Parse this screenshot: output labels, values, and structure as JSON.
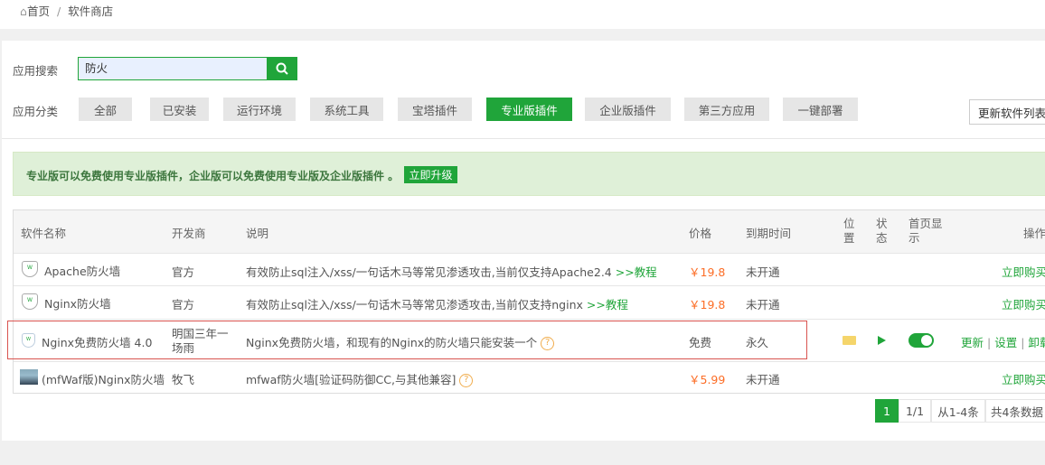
{
  "breadcrumb": {
    "home": "首页",
    "sep": "/",
    "current": "软件商店"
  },
  "search": {
    "label": "应用搜索",
    "value": "防火"
  },
  "category": {
    "label": "应用分类",
    "items": [
      "全部",
      "已安装",
      "运行环境",
      "系统工具",
      "宝塔插件",
      "专业版插件",
      "企业版插件",
      "第三方应用",
      "一键部署"
    ],
    "active": "专业版插件",
    "refresh": "更新软件列表"
  },
  "alert": {
    "text": "专业版可以免费使用专业版插件，企业版可以免费使用专业版及企业版插件 。",
    "button": "立即升级"
  },
  "table": {
    "headers": {
      "name": "软件名称",
      "dev": "开发商",
      "desc": "说明",
      "price": "价格",
      "expire": "到期时间",
      "pos": "位置",
      "status": "状态",
      "home": "首页显示",
      "ops": "操作"
    },
    "rows": [
      {
        "name": "Apache防火墙",
        "dev": "官方",
        "desc": "有效防止sql注入/xss/一句话木马等常见渗透攻击,当前仅支持Apache2.4",
        "link": ">>教程",
        "price": "￥19.8",
        "expire": "未开通",
        "op": "立即购买"
      },
      {
        "name": "Nginx防火墙",
        "dev": "官方",
        "desc": "有效防止sql注入/xss/一句话木马等常见渗透攻击,当前仅支持nginx",
        "link": ">>教程",
        "price": "￥19.8",
        "expire": "未开通",
        "op": "立即购买"
      },
      {
        "name": "Nginx免费防火墙 4.0",
        "dev": "明国三年一场雨",
        "desc": "Nginx免费防火墙，和现有的Nginx的防火墙只能安装一个",
        "price": "免费",
        "expire": "永久",
        "ops": [
          "更新",
          "设置",
          "卸载"
        ],
        "home_display": true
      },
      {
        "name": "(mfWaf版)Nginx防火墙",
        "dev": "牧飞",
        "desc": "mfwaf防火墙[验证码防御CC,与其他兼容]",
        "price": "￥5.99",
        "expire": "未开通",
        "op": "立即购买"
      }
    ]
  },
  "pagination": {
    "current": "1",
    "pages": "1/1",
    "range": "从1-4条",
    "total": "共4条数据"
  },
  "colors": {
    "accent": "#20a53a",
    "price": "#fc6d26",
    "highlight": "#d9534f"
  }
}
